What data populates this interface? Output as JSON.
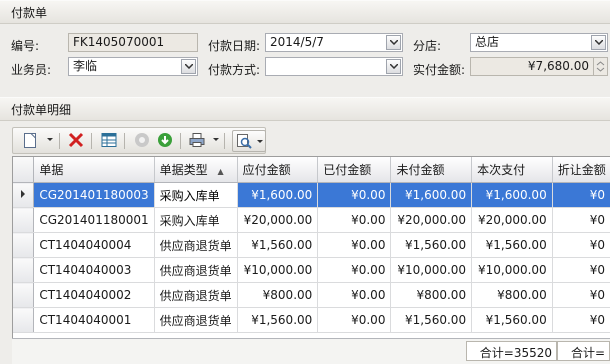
{
  "payment_section": {
    "title": "付款单",
    "code_label": "编号:",
    "code_value": "FK1405070001",
    "date_label": "付款日期:",
    "date_value": "2014/5/7",
    "branch_label": "分店:",
    "branch_value": "总店",
    "staff_label": "业务员:",
    "staff_value": "李临",
    "method_label": "付款方式:",
    "method_value": "",
    "amount_label": "实付金额:",
    "amount_value": "¥7,680.00"
  },
  "detail_section": {
    "title": "付款单明细"
  },
  "toolbar": {
    "icons": [
      "new-doc-icon",
      "delete-icon",
      "spreadsheet-icon",
      "disabled-circle-icon",
      "download-circle-icon",
      "print-icon",
      "preview-icon"
    ]
  },
  "grid": {
    "columns": [
      "单据",
      "单据类型",
      "应付金额",
      "已付金额",
      "未付金额",
      "本次支付",
      "折让金额"
    ],
    "sort_indicator": "▲",
    "rows": [
      {
        "doc": "CG201401180003",
        "type": "采购入库单",
        "payable": "¥1,600.00",
        "paid": "¥0.00",
        "unpaid": "¥1,600.00",
        "current": "¥1,600.00",
        "discount": "¥0"
      },
      {
        "doc": "CG201401180001",
        "type": "采购入库单",
        "payable": "¥20,000.00",
        "paid": "¥0.00",
        "unpaid": "¥20,000.00",
        "current": "¥20,000.00",
        "discount": "¥0"
      },
      {
        "doc": "CT1404040004",
        "type": "供应商退货单",
        "payable": "¥1,560.00",
        "paid": "¥0.00",
        "unpaid": "¥1,560.00",
        "current": "¥1,560.00",
        "discount": "¥0"
      },
      {
        "doc": "CT1404040003",
        "type": "供应商退货单",
        "payable": "¥10,000.00",
        "paid": "¥0.00",
        "unpaid": "¥10,000.00",
        "current": "¥10,000.00",
        "discount": "¥0"
      },
      {
        "doc": "CT1404040002",
        "type": "供应商退货单",
        "payable": "¥800.00",
        "paid": "¥0.00",
        "unpaid": "¥800.00",
        "current": "¥800.00",
        "discount": "¥0"
      },
      {
        "doc": "CT1404040001",
        "type": "供应商退货单",
        "payable": "¥1,560.00",
        "paid": "¥0.00",
        "unpaid": "¥1,560.00",
        "current": "¥1,560.00",
        "discount": "¥0"
      }
    ],
    "footer_sum": "合计=35520",
    "footer_sum2": "合计="
  },
  "colors": {
    "selection": "#3b78d6",
    "background": "#eeedea"
  }
}
